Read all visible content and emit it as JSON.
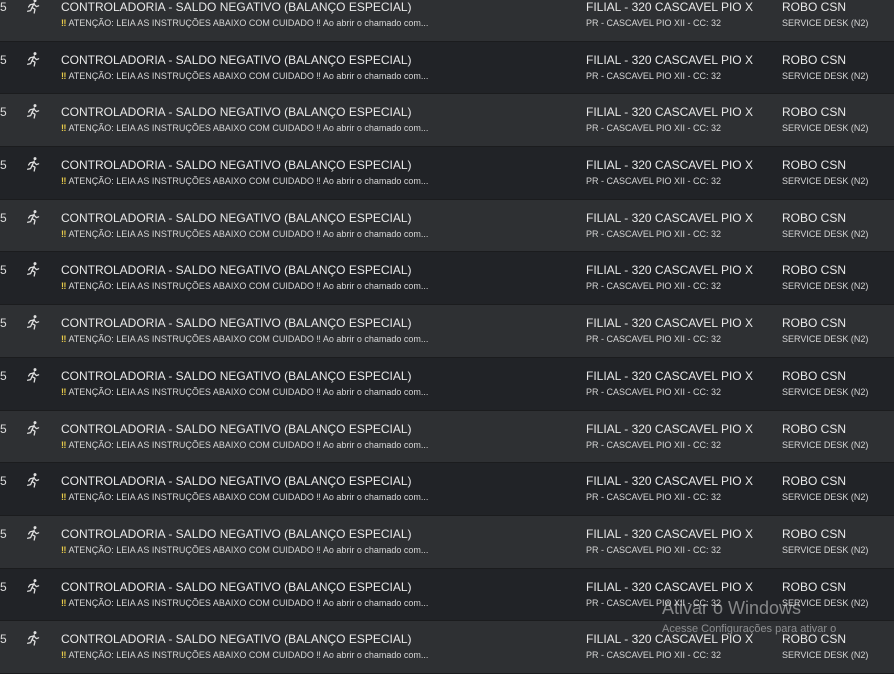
{
  "tickets": [
    {
      "number": "5",
      "title": "CONTROLADORIA - SALDO NEGATIVO (BALANÇO ESPECIAL)",
      "warn_mark": "‼",
      "description": "ATENÇÃO: LEIA AS INSTRUÇÕES ABAIXO COM CUIDADO ‼ Ao abrir o chamado com...",
      "branch": "FILIAL - 320 CASCAVEL PIO X",
      "location": "PR - CASCAVEL PIO XII - CC: 32",
      "requester": "ROBO CSN",
      "team": "SERVICE DESK (N2)"
    },
    {
      "number": "5",
      "title": "CONTROLADORIA - SALDO NEGATIVO (BALANÇO ESPECIAL)",
      "warn_mark": "‼",
      "description": "ATENÇÃO: LEIA AS INSTRUÇÕES ABAIXO COM CUIDADO ‼ Ao abrir o chamado com...",
      "branch": "FILIAL - 320 CASCAVEL PIO X",
      "location": "PR - CASCAVEL PIO XII - CC: 32",
      "requester": "ROBO CSN",
      "team": "SERVICE DESK (N2)"
    },
    {
      "number": "5",
      "title": "CONTROLADORIA - SALDO NEGATIVO (BALANÇO ESPECIAL)",
      "warn_mark": "‼",
      "description": "ATENÇÃO: LEIA AS INSTRUÇÕES ABAIXO COM CUIDADO ‼ Ao abrir o chamado com...",
      "branch": "FILIAL - 320 CASCAVEL PIO X",
      "location": "PR - CASCAVEL PIO XII - CC: 32",
      "requester": "ROBO CSN",
      "team": "SERVICE DESK (N2)"
    },
    {
      "number": "5",
      "title": "CONTROLADORIA - SALDO NEGATIVO (BALANÇO ESPECIAL)",
      "warn_mark": "‼",
      "description": "ATENÇÃO: LEIA AS INSTRUÇÕES ABAIXO COM CUIDADO ‼ Ao abrir o chamado com...",
      "branch": "FILIAL - 320 CASCAVEL PIO X",
      "location": "PR - CASCAVEL PIO XII - CC: 32",
      "requester": "ROBO CSN",
      "team": "SERVICE DESK (N2)"
    },
    {
      "number": "5",
      "title": "CONTROLADORIA - SALDO NEGATIVO (BALANÇO ESPECIAL)",
      "warn_mark": "‼",
      "description": "ATENÇÃO: LEIA AS INSTRUÇÕES ABAIXO COM CUIDADO ‼ Ao abrir o chamado com...",
      "branch": "FILIAL - 320 CASCAVEL PIO X",
      "location": "PR - CASCAVEL PIO XII - CC: 32",
      "requester": "ROBO CSN",
      "team": "SERVICE DESK (N2)"
    },
    {
      "number": "5",
      "title": "CONTROLADORIA - SALDO NEGATIVO (BALANÇO ESPECIAL)",
      "warn_mark": "‼",
      "description": "ATENÇÃO: LEIA AS INSTRUÇÕES ABAIXO COM CUIDADO ‼ Ao abrir o chamado com...",
      "branch": "FILIAL - 320 CASCAVEL PIO X",
      "location": "PR - CASCAVEL PIO XII - CC: 32",
      "requester": "ROBO CSN",
      "team": "SERVICE DESK (N2)"
    },
    {
      "number": "5",
      "title": "CONTROLADORIA - SALDO NEGATIVO (BALANÇO ESPECIAL)",
      "warn_mark": "‼",
      "description": "ATENÇÃO: LEIA AS INSTRUÇÕES ABAIXO COM CUIDADO ‼ Ao abrir o chamado com...",
      "branch": "FILIAL - 320 CASCAVEL PIO X",
      "location": "PR - CASCAVEL PIO XII - CC: 32",
      "requester": "ROBO CSN",
      "team": "SERVICE DESK (N2)"
    },
    {
      "number": "5",
      "title": "CONTROLADORIA - SALDO NEGATIVO (BALANÇO ESPECIAL)",
      "warn_mark": "‼",
      "description": "ATENÇÃO: LEIA AS INSTRUÇÕES ABAIXO COM CUIDADO ‼ Ao abrir o chamado com...",
      "branch": "FILIAL - 320 CASCAVEL PIO X",
      "location": "PR - CASCAVEL PIO XII - CC: 32",
      "requester": "ROBO CSN",
      "team": "SERVICE DESK (N2)"
    },
    {
      "number": "5",
      "title": "CONTROLADORIA - SALDO NEGATIVO (BALANÇO ESPECIAL)",
      "warn_mark": "‼",
      "description": "ATENÇÃO: LEIA AS INSTRUÇÕES ABAIXO COM CUIDADO ‼ Ao abrir o chamado com...",
      "branch": "FILIAL - 320 CASCAVEL PIO X",
      "location": "PR - CASCAVEL PIO XII - CC: 32",
      "requester": "ROBO CSN",
      "team": "SERVICE DESK (N2)"
    },
    {
      "number": "5",
      "title": "CONTROLADORIA - SALDO NEGATIVO (BALANÇO ESPECIAL)",
      "warn_mark": "‼",
      "description": "ATENÇÃO: LEIA AS INSTRUÇÕES ABAIXO COM CUIDADO ‼ Ao abrir o chamado com...",
      "branch": "FILIAL - 320 CASCAVEL PIO X",
      "location": "PR - CASCAVEL PIO XII - CC: 32",
      "requester": "ROBO CSN",
      "team": "SERVICE DESK (N2)"
    },
    {
      "number": "5",
      "title": "CONTROLADORIA - SALDO NEGATIVO (BALANÇO ESPECIAL)",
      "warn_mark": "‼",
      "description": "ATENÇÃO: LEIA AS INSTRUÇÕES ABAIXO COM CUIDADO ‼ Ao abrir o chamado com...",
      "branch": "FILIAL - 320 CASCAVEL PIO X",
      "location": "PR - CASCAVEL PIO XII - CC: 32",
      "requester": "ROBO CSN",
      "team": "SERVICE DESK (N2)"
    },
    {
      "number": "5",
      "title": "CONTROLADORIA - SALDO NEGATIVO (BALANÇO ESPECIAL)",
      "warn_mark": "‼",
      "description": "ATENÇÃO: LEIA AS INSTRUÇÕES ABAIXO COM CUIDADO ‼ Ao abrir o chamado com...",
      "branch": "FILIAL - 320 CASCAVEL PIO X",
      "location": "PR - CASCAVEL PIO XII - CC: 32",
      "requester": "ROBO CSN",
      "team": "SERVICE DESK (N2)"
    },
    {
      "number": "5",
      "title": "CONTROLADORIA - SALDO NEGATIVO (BALANÇO ESPECIAL)",
      "warn_mark": "‼",
      "description": "ATENÇÃO: LEIA AS INSTRUÇÕES ABAIXO COM CUIDADO ‼ Ao abrir o chamado com...",
      "branch": "FILIAL - 320 CASCAVEL PIO X",
      "location": "PR - CASCAVEL PIO XII - CC: 32",
      "requester": "ROBO CSN",
      "team": "SERVICE DESK (N2)"
    }
  ],
  "row_icon": "running-person-icon",
  "colors": {
    "row_light": "#2e3033",
    "row_dark": "#212327",
    "warning": "#e6c94a"
  },
  "watermark": {
    "title": "Ativar o Windows",
    "subtitle": "Acesse Configurações para ativar o"
  }
}
